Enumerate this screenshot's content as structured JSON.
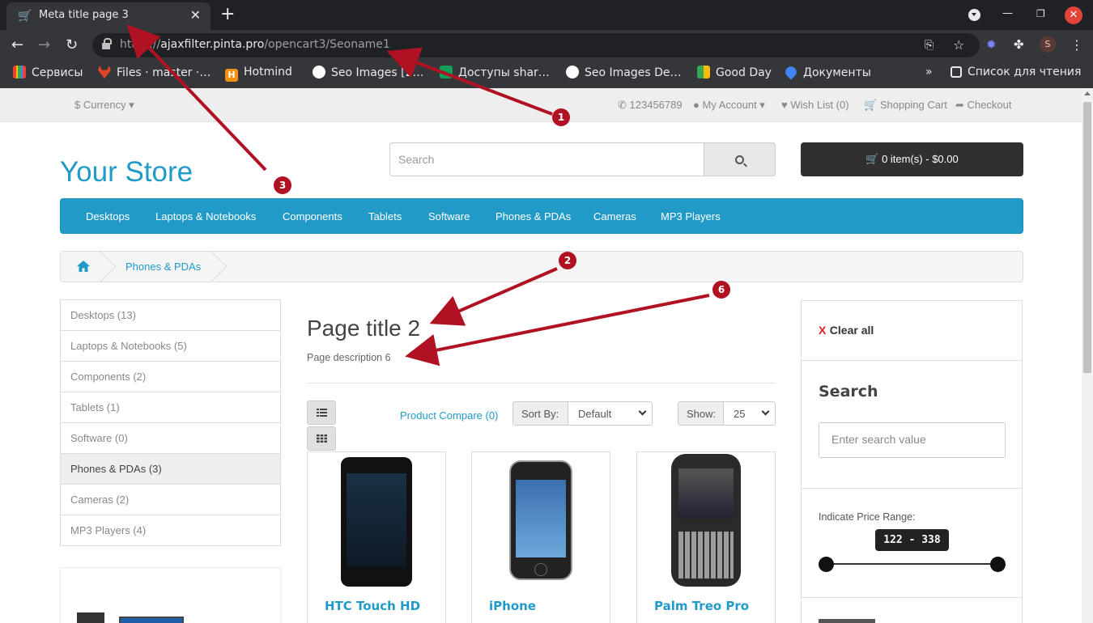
{
  "browser": {
    "tab_title": "Meta title page 3",
    "tab_close": "✕",
    "new_tab": "+",
    "url_prefix": "https://",
    "url_host": "ajaxfilter.pinta.pro",
    "url_path": "/opencart3/Seoname1",
    "avatar_letter": "S",
    "bookmarks": [
      {
        "label": "Сервисы",
        "color": "#e94235"
      },
      {
        "label": "Files · master ·…",
        "color": "#e24329"
      },
      {
        "label": "Hotmind",
        "color": "#f29111"
      },
      {
        "label": "Seo Images [2…",
        "color": "#ffffff"
      },
      {
        "label": "Доступы shar…",
        "color": "#0f9d58"
      },
      {
        "label": "Seo Images De…",
        "color": "#ffffff"
      },
      {
        "label": "Good Day",
        "color": "#34a853"
      },
      {
        "label": "Документы",
        "color": "#4285f4"
      }
    ],
    "more_bookmarks": "»",
    "reading_list": "Список для чтения"
  },
  "topbar": {
    "currency": "$ Currency",
    "phone": "123456789",
    "account": "My Account",
    "wishlist": "Wish List (0)",
    "cart": "Shopping Cart",
    "checkout": "Checkout"
  },
  "header": {
    "logo": "Your Store",
    "search_placeholder": "Search",
    "cart_button": "0 item(s) - $0.00"
  },
  "menu": [
    "Desktops",
    "Laptops & Notebooks",
    "Components",
    "Tablets",
    "Software",
    "Phones & PDAs",
    "Cameras",
    "MP3 Players"
  ],
  "breadcrumb": {
    "current": "Phones & PDAs"
  },
  "categories": [
    {
      "label": "Desktops (13)",
      "active": false
    },
    {
      "label": "Laptops & Notebooks (5)",
      "active": false
    },
    {
      "label": "Components (2)",
      "active": false
    },
    {
      "label": "Tablets (1)",
      "active": false
    },
    {
      "label": "Software (0)",
      "active": false
    },
    {
      "label": "Phones & PDAs (3)",
      "active": true
    },
    {
      "label": "Cameras (2)",
      "active": false
    },
    {
      "label": "MP3 Players (4)",
      "active": false
    }
  ],
  "content": {
    "title": "Page title 2",
    "description": "Page description 6",
    "product_compare": "Product Compare (0)",
    "sort_by_label": "Sort By:",
    "sort_by_value": "Default",
    "show_label": "Show:",
    "show_value": "25"
  },
  "products": [
    {
      "name": "HTC Touch HD"
    },
    {
      "name": "iPhone"
    },
    {
      "name": "Palm Treo Pro"
    }
  ],
  "filter": {
    "clear_x": "X",
    "clear_all": "Clear all",
    "search_title": "Search",
    "search_placeholder": "Enter search value",
    "price_label": "Indicate Price Range:",
    "price_min": "122",
    "price_max": "338",
    "price_sep": " - "
  },
  "annotations": [
    "1",
    "2",
    "3",
    "6"
  ],
  "colors": {
    "accent": "#229ac8",
    "annotation": "#b01224",
    "cart_button": "#303030"
  }
}
